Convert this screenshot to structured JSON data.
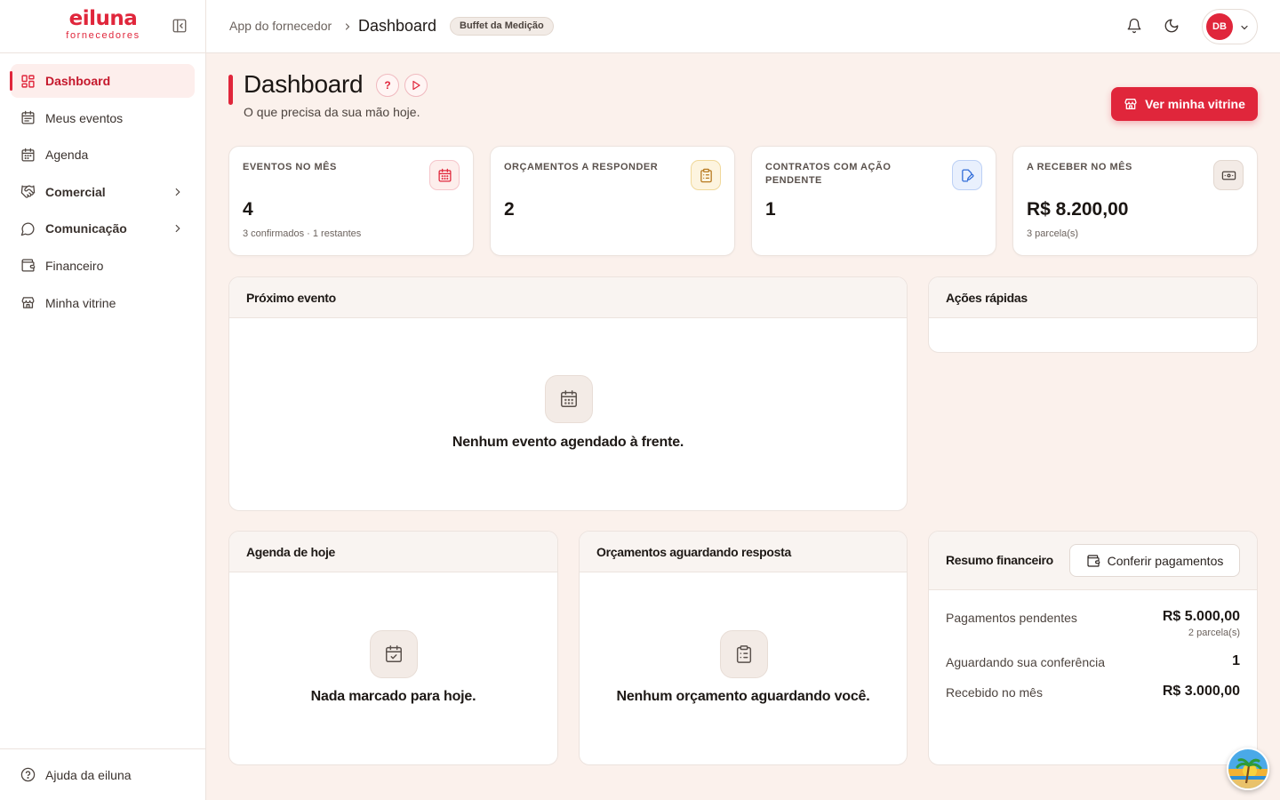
{
  "brand": {
    "logo_main": "eiluna",
    "logo_sub": "fornecedores"
  },
  "sidebar": {
    "items": [
      {
        "label": "Dashboard",
        "icon": "layout-grid-icon"
      },
      {
        "label": "Meus eventos",
        "icon": "calendar-list-icon"
      },
      {
        "label": "Agenda",
        "icon": "calendar-icon"
      },
      {
        "label": "Comercial",
        "icon": "handshake-icon"
      },
      {
        "label": "Comunicação",
        "icon": "message-circle-icon"
      },
      {
        "label": "Financeiro",
        "icon": "wallet-icon"
      },
      {
        "label": "Minha vitrine",
        "icon": "store-icon"
      }
    ],
    "footer_label": "Ajuda da eiluna"
  },
  "topbar": {
    "breadcrumb_parent": "App do fornecedor",
    "breadcrumb_current": "Dashboard",
    "badge": "Buffet da Medição",
    "avatar_initials": "DB"
  },
  "header": {
    "title": "Dashboard",
    "help": "?",
    "subtitle": "O que precisa da sua mão hoje.",
    "cta": "Ver minha vitrine"
  },
  "stats": [
    {
      "label": "EVENTOS NO MÊS",
      "value": "4",
      "sub": "3 confirmados · 1 restantes",
      "icon": "calendar-icon"
    },
    {
      "label": "ORÇAMENTOS A RESPONDER",
      "value": "2",
      "sub": "",
      "icon": "clipboard-icon"
    },
    {
      "label": "CONTRATOS COM AÇÃO PENDENTE",
      "value": "1",
      "sub": "",
      "icon": "edit-document-icon"
    },
    {
      "label": "A RECEBER NO MÊS",
      "value": "R$ 8.200,00",
      "sub": "3 parcela(s)",
      "icon": "banknote-icon"
    }
  ],
  "panels": {
    "next_event": {
      "title": "Próximo evento",
      "empty": "Nenhum evento agendado à frente."
    },
    "quick_actions": {
      "title": "Ações rápidas"
    },
    "today": {
      "title": "Agenda de hoje",
      "empty": "Nada marcado para hoje."
    },
    "quotes": {
      "title": "Orçamentos aguardando resposta",
      "empty": "Nenhum orçamento aguardando você."
    },
    "finance": {
      "title": "Resumo financeiro",
      "button": "Conferir pagamentos",
      "rows": [
        {
          "label": "Pagamentos pendentes",
          "value": "R$ 5.000,00",
          "sub": "2 parcela(s)"
        },
        {
          "label": "Aguardando sua conferência",
          "value": "1"
        },
        {
          "label": "Recebido no mês",
          "value": "R$ 3.000,00"
        }
      ]
    }
  },
  "colors": {
    "accent": "#e0263b",
    "background": "#fbf1ec",
    "surface": "#ffffff"
  }
}
